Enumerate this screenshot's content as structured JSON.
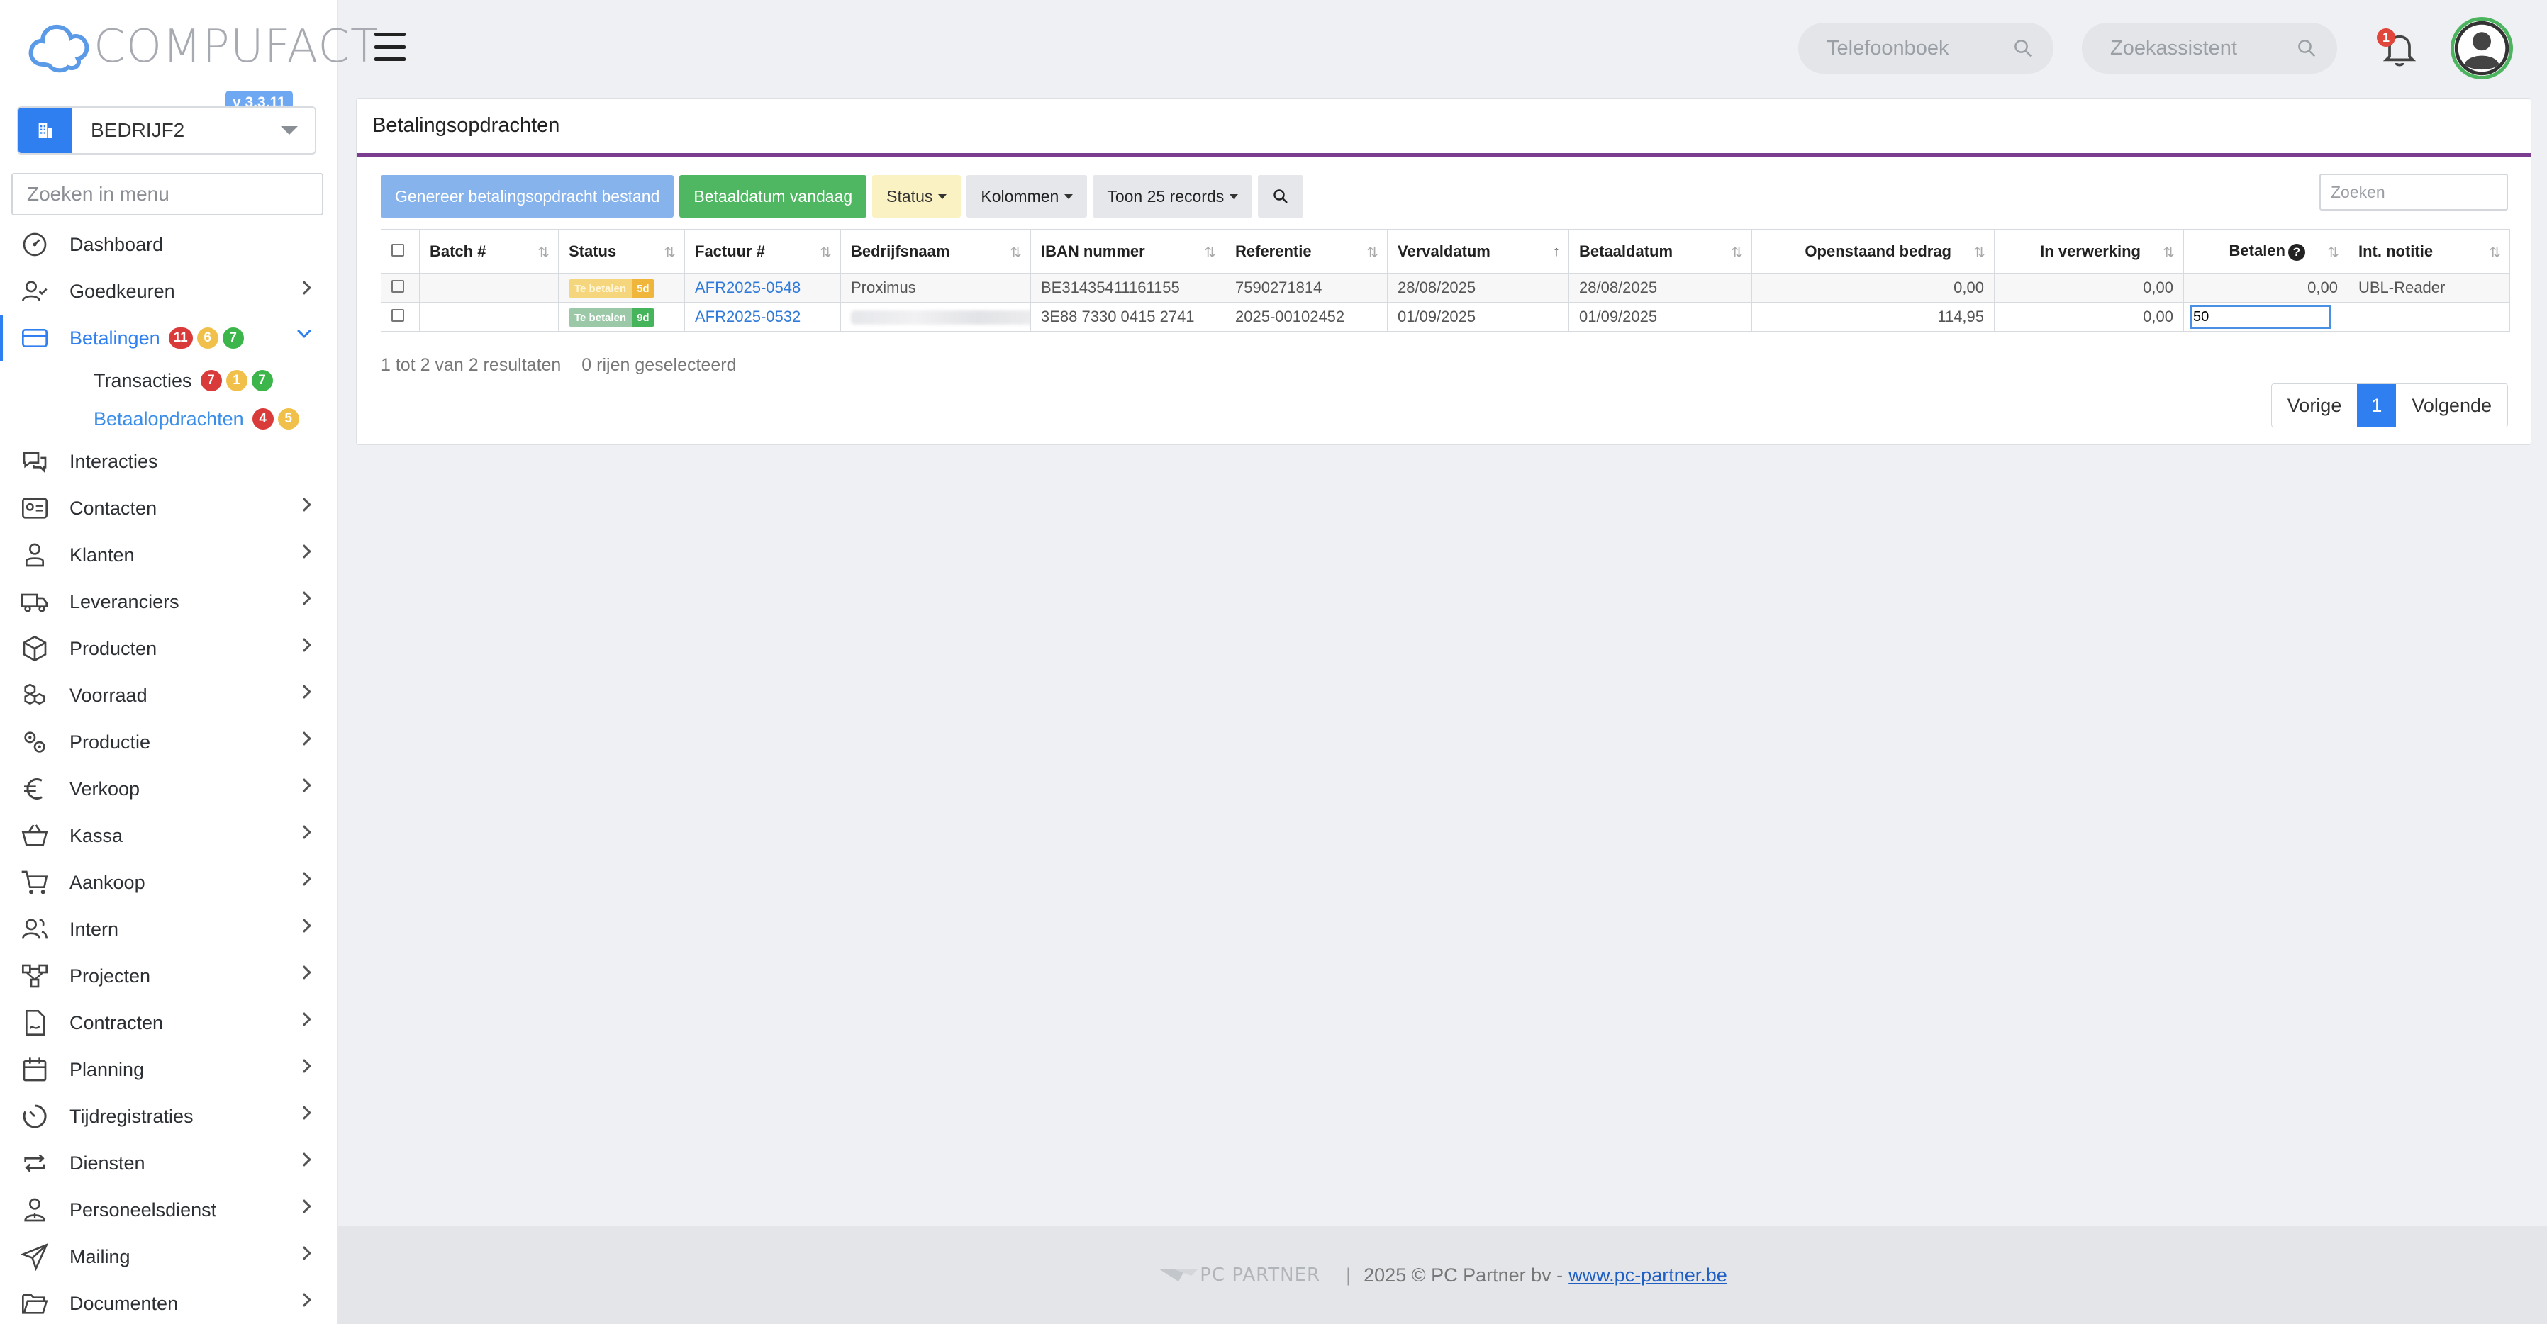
{
  "app": {
    "logo_text": "COMPUFACT",
    "version": "v 3.3.11",
    "company": "BEDRIJF2",
    "menu_search_placeholder": "Zoeken in menu"
  },
  "topbar": {
    "phonebook_placeholder": "Telefoonboek",
    "assistant_placeholder": "Zoekassistent",
    "notification_count": "1"
  },
  "menu": {
    "dashboard": "Dashboard",
    "goedkeuren": "Goedkeuren",
    "betalingen": "Betalingen",
    "betalingen_badges": [
      "11",
      "6",
      "7"
    ],
    "transacties": "Transacties",
    "transacties_badges": [
      "7",
      "1",
      "7"
    ],
    "betaalopdrachten": "Betaalopdrachten",
    "betaalopdrachten_badges": [
      "4",
      "5"
    ],
    "interacties": "Interacties",
    "contacten": "Contacten",
    "klanten": "Klanten",
    "leveranciers": "Leveranciers",
    "producten": "Producten",
    "voorraad": "Voorraad",
    "productie": "Productie",
    "verkoop": "Verkoop",
    "kassa": "Kassa",
    "aankoop": "Aankoop",
    "intern": "Intern",
    "projecten": "Projecten",
    "contracten": "Contracten",
    "planning": "Planning",
    "tijdregistraties": "Tijdregistraties",
    "diensten": "Diensten",
    "personeelsdienst": "Personeelsdienst",
    "mailing": "Mailing",
    "documenten": "Documenten"
  },
  "page": {
    "title": "Betalingsopdrachten",
    "toolbar": {
      "generate": "Genereer betalingsopdracht bestand",
      "today": "Betaaldatum vandaag",
      "status": "Status",
      "columns": "Kolommen",
      "records": "Toon 25 records"
    },
    "table_search_placeholder": "Zoeken",
    "columns": [
      "Batch #",
      "Status",
      "Factuur #",
      "Bedrijfsnaam",
      "IBAN nummer",
      "Referentie",
      "Vervaldatum",
      "Betaaldatum",
      "Openstaand bedrag",
      "In verwerking",
      "Betalen",
      "Int. notitie"
    ],
    "rows": [
      {
        "batch": "",
        "status_label": "Te betalen",
        "status_days": "5d",
        "factuur": "AFR2025-0548",
        "bedrijf": "Proximus",
        "iban": "BE31435411161155",
        "referentie": "7590271814",
        "vervaldatum": "28/08/2025",
        "betaaldatum": "28/08/2025",
        "openstaand": "0,00",
        "verwerking": "0,00",
        "betalen": "0,00",
        "notitie": "UBL-Reader"
      },
      {
        "batch": "",
        "status_label": "Te betalen",
        "status_days": "9d",
        "factuur": "AFR2025-0532",
        "bedrijf": "",
        "iban": "3E88 7330 0415 2741",
        "referentie": "2025-00102452",
        "vervaldatum": "01/09/2025",
        "betaaldatum": "01/09/2025",
        "openstaand": "114,95",
        "verwerking": "0,00",
        "betalen": "50",
        "notitie": ""
      }
    ],
    "result_info": "1 tot 2 van 2 resultaten",
    "selected_info": "0 rijen geselecteerd",
    "pager": {
      "prev": "Vorige",
      "current": "1",
      "next": "Volgende"
    }
  },
  "footer": {
    "brand": "PC PARTNER",
    "separator": "|",
    "copyright": "2025 © PC Partner bv -",
    "link": "www.pc-partner.be"
  },
  "colors": {
    "accent": "#2f7ff0",
    "title_underline": "#7a3d8f",
    "green": "#4fb761",
    "red": "#d93a3a",
    "yellow": "#f0c04a"
  }
}
